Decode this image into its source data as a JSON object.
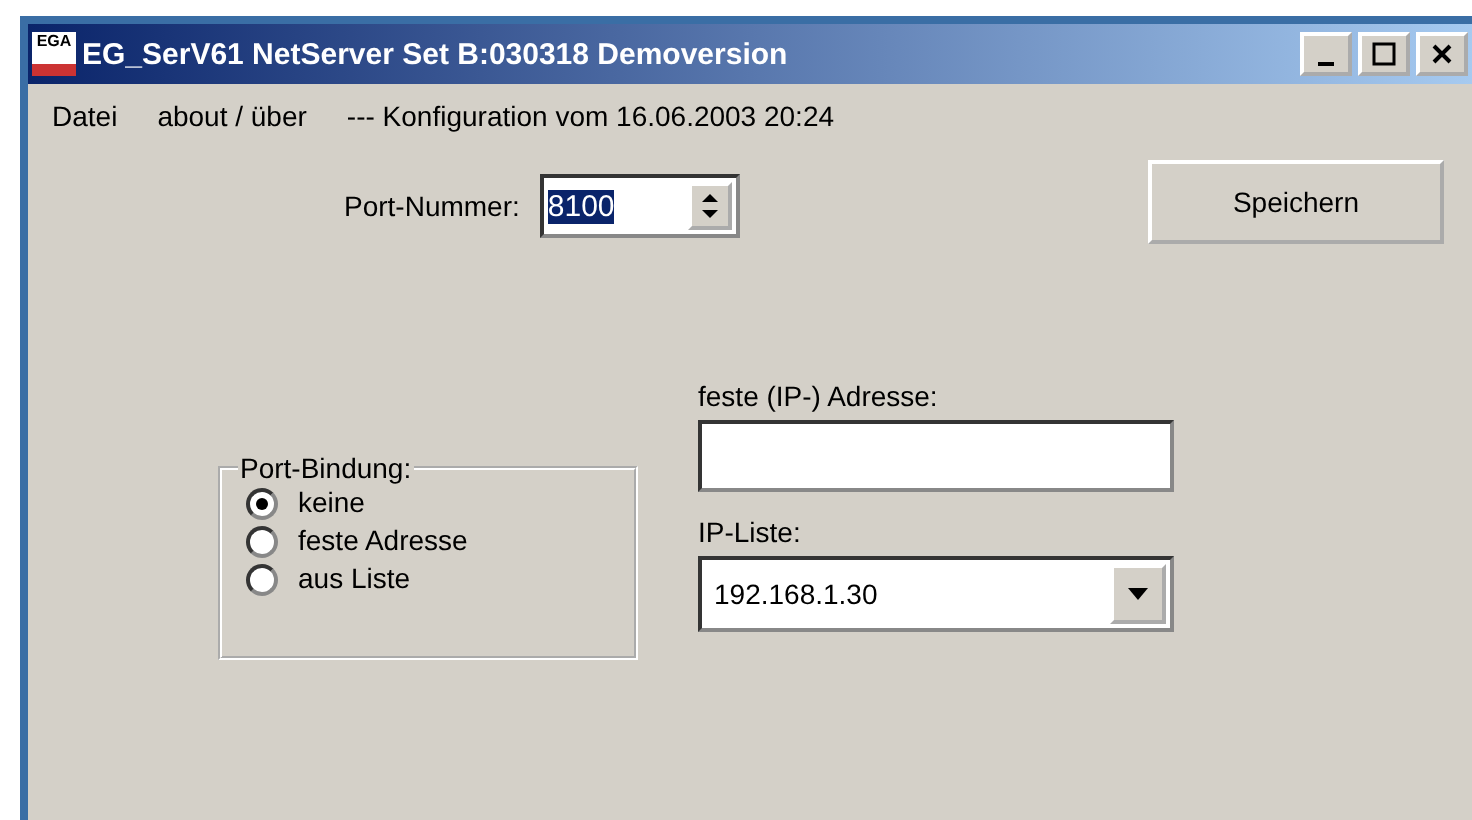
{
  "window": {
    "title": "EG_SerV61 NetServer Set B:030318 Demoversion",
    "logo_text": "EGA"
  },
  "menu": [
    {
      "label": "Datei"
    },
    {
      "label": "about / über"
    }
  ],
  "menu_info": "--- Konfiguration vom 16.06.2003 20:24",
  "port": {
    "label": "Port-Nummer:",
    "value": "8100"
  },
  "save_button": "Speichern",
  "port_binding": {
    "title": "Port-Bindung:",
    "options": [
      {
        "label": "keine",
        "selected": true
      },
      {
        "label": "feste Adresse",
        "selected": false
      },
      {
        "label": "aus Liste",
        "selected": false
      }
    ]
  },
  "fixed_address": {
    "label": "feste (IP-) Adresse:"
  },
  "ip_list": {
    "label": "IP-Liste:",
    "value": "192.168.1.30"
  }
}
